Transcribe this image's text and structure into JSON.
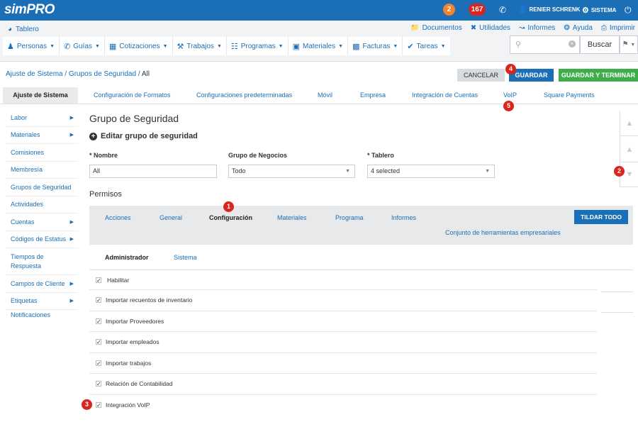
{
  "app": {
    "logo": "simPRO",
    "badge_orange": "2",
    "badge_red": "167",
    "user": "RENIER SCHRENK",
    "sistema": "SISTEMA"
  },
  "subbar": {
    "tablero": "Tablero",
    "links": [
      "Documentos",
      "Utilidades",
      "Informes",
      "Ayuda",
      "Imprimir"
    ],
    "nav": [
      "Personas",
      "Guías",
      "Cotizaciones",
      "Trabajos",
      "Programas",
      "Materiales",
      "Facturas",
      "Tareas"
    ],
    "search_placeholder": "",
    "search_button": "Buscar"
  },
  "breadcrumb": {
    "items": [
      "Ajuste de Sistema",
      "Grupos de Seguridad"
    ],
    "current": "All"
  },
  "actions": {
    "cancel": "CANCELAR",
    "save": "GUARDAR",
    "save_finish": "GUARDAR Y TERMINAR"
  },
  "tabs": [
    "Ajuste de Sistema",
    "Configuración de Formatos",
    "Configuraciones predeterminadas",
    "Móvil",
    "Empresa",
    "Integración de Cuentas",
    "VoIP",
    "Square Payments"
  ],
  "leftnav": [
    "Labor",
    "Materiales",
    "Comisiones",
    "Membresía",
    "Grupos de Seguridad",
    "Actividades",
    "Cuentas",
    "Códigos de Estatus",
    "Tiempos de Respuesta",
    "Campos de Cliente",
    "Etiquetas",
    "Notificaciones"
  ],
  "form": {
    "title": "Grupo de Seguridad",
    "subtitle": "Editar grupo de seguridad",
    "nombre_label": "* Nombre",
    "nombre_value": "All",
    "negocios_label": "Grupo de Negocios",
    "negocios_value": "Todo",
    "tablero_label": "* Tablero",
    "tablero_value": "4 selected",
    "permisos": "Permisos"
  },
  "perm_tabs": {
    "tabs": [
      "Acciones",
      "General",
      "Configuración",
      "Materiales",
      "Programa",
      "Informes"
    ],
    "extra": "Conjunto de herramientas empresariales",
    "tildar": "TILDAR TODO",
    "sub": [
      "Administrador",
      "Sistema"
    ]
  },
  "permissions": [
    "Habilitar",
    "Importar recuentos de inventario",
    "Importar Proveedores",
    "Importar empleados",
    "Importar trabajos",
    "Relación de Contabilidad",
    "Integración VoIP"
  ],
  "markers": [
    "1",
    "2",
    "3",
    "4",
    "5"
  ],
  "colors": {
    "primary": "#1b6fb7",
    "success": "#3dae4a",
    "marker": "#d9251d",
    "badge_orange": "#f4832a"
  }
}
